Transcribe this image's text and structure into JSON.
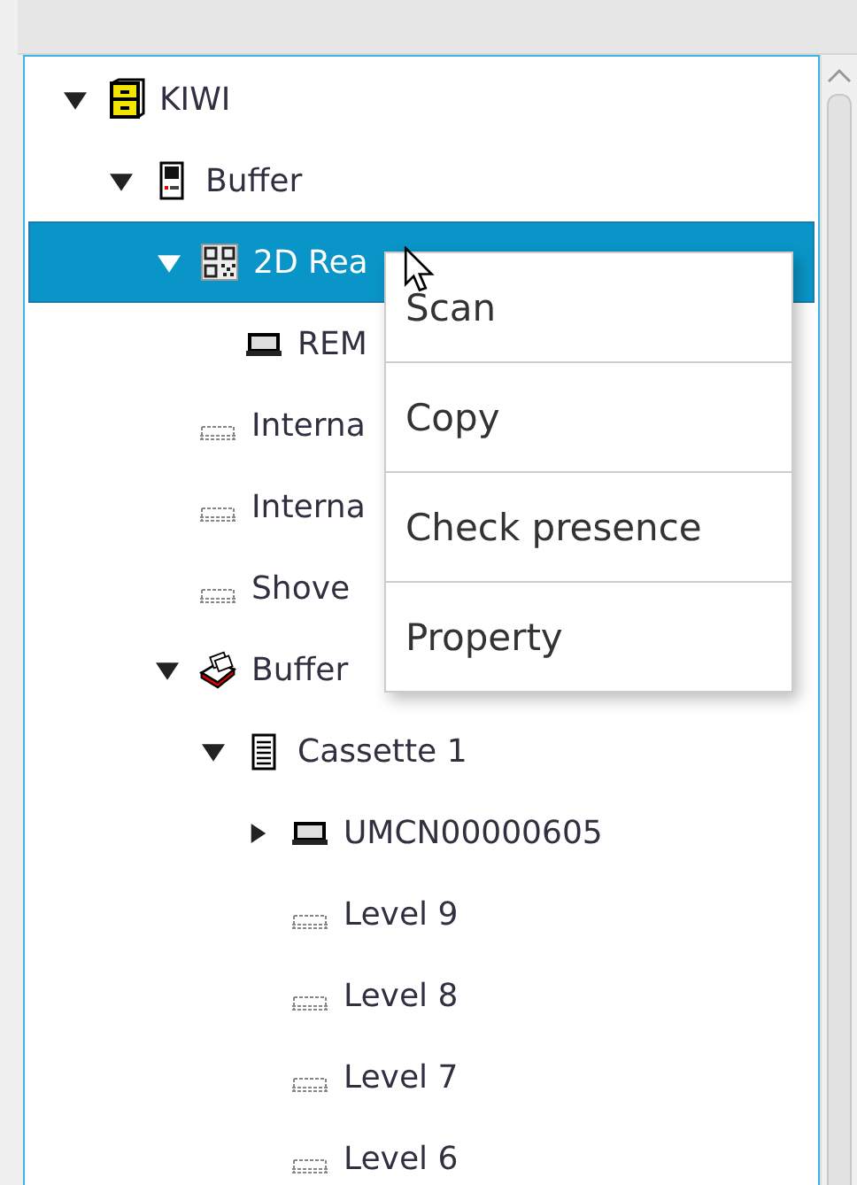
{
  "tree": [
    {
      "label": "KIWI",
      "kind": "cabinet",
      "expanded": true,
      "selected": false,
      "children": [
        {
          "label": "Buffer",
          "kind": "panel",
          "expanded": true,
          "selected": false,
          "children": [
            {
              "label": "2D Rea",
              "kind": "qr",
              "expanded": true,
              "selected": true,
              "children": [
                {
                  "label": "REM",
                  "kind": "tray",
                  "selected": false
                }
              ]
            },
            {
              "label": "Interna",
              "kind": "shelf",
              "selected": false
            },
            {
              "label": "Interna",
              "kind": "shelf",
              "selected": false
            },
            {
              "label": "Shove",
              "kind": "shelf",
              "selected": false
            },
            {
              "label": "Buffer",
              "kind": "drawer",
              "expanded": true,
              "selected": false,
              "children": [
                {
                  "label": "Cassette 1",
                  "kind": "cassette",
                  "expanded": true,
                  "selected": false,
                  "children": [
                    {
                      "label": "UMCN00000605",
                      "kind": "tray",
                      "expanded": false,
                      "selected": false
                    },
                    {
                      "label": "Level 9",
                      "kind": "shelf",
                      "selected": false
                    },
                    {
                      "label": "Level 8",
                      "kind": "shelf",
                      "selected": false
                    },
                    {
                      "label": "Level 7",
                      "kind": "shelf",
                      "selected": false
                    },
                    {
                      "label": "Level 6",
                      "kind": "shelf",
                      "selected": false
                    }
                  ]
                }
              ]
            }
          ]
        }
      ]
    }
  ],
  "context_menu": [
    "Scan",
    "Copy",
    "Check presence",
    "Property"
  ]
}
